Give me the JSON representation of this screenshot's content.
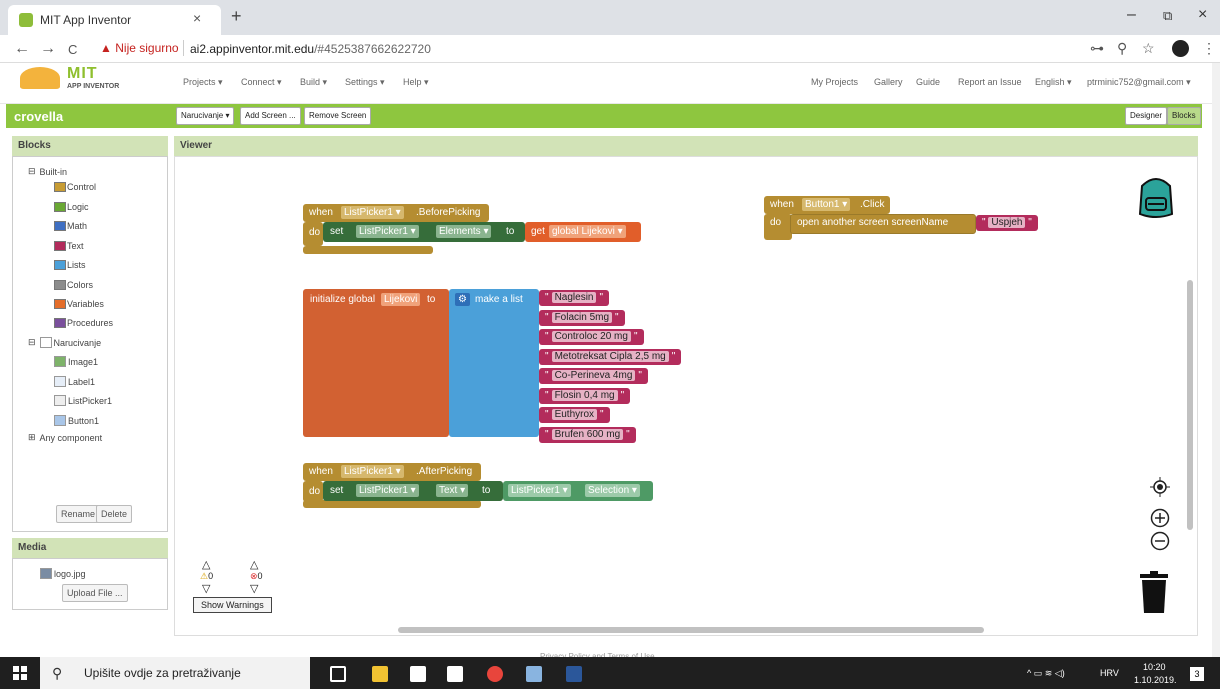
{
  "browser": {
    "tab_title": "MIT App Inventor",
    "tab_close": "×",
    "new_tab": "+",
    "security_warning": "Nije sigurno",
    "url_host": "ai2.appinventor.mit.edu",
    "url_path": "/#4525387662622720",
    "back": "←",
    "forward": "→",
    "reload": "C",
    "warn_icon": "▲",
    "key_icon": "⊶",
    "zoom_icon": "⚲",
    "star_icon": "☆",
    "menu_icon": "⋮",
    "minimize": "–",
    "restore": "⧉",
    "close": "×"
  },
  "app": {
    "logo_mit": "MIT",
    "logo_sub": "APP INVENTOR",
    "menu": [
      {
        "label": "Projects ▾"
      },
      {
        "label": "Connect ▾"
      },
      {
        "label": "Build ▾"
      },
      {
        "label": "Settings ▾"
      },
      {
        "label": "Help ▾"
      }
    ],
    "right_menu": [
      {
        "label": "My Projects"
      },
      {
        "label": "Gallery"
      },
      {
        "label": "Guide"
      },
      {
        "label": "Report an Issue"
      },
      {
        "label": "English ▾"
      },
      {
        "label": "ptrminic752@gmail.com ▾"
      }
    ],
    "project_name": "crovella",
    "screen_select": "Narucivanje ▾",
    "add_screen": "Add Screen ...",
    "remove_screen": "Remove Screen",
    "designer": "Designer",
    "blocks_btn": "Blocks"
  },
  "blocks_panel": {
    "header": "Blocks",
    "builtin": "Built-in",
    "builtin_toggle": "⊟",
    "categories": [
      {
        "label": "Control",
        "color": "#c79c34"
      },
      {
        "label": "Logic",
        "color": "#6aa834"
      },
      {
        "label": "Math",
        "color": "#3f6fc2"
      },
      {
        "label": "Text",
        "color": "#b32c5c"
      },
      {
        "label": "Lists",
        "color": "#4ba0d9"
      },
      {
        "label": "Colors",
        "color": "#8c8c8c"
      },
      {
        "label": "Variables",
        "color": "#e46d2a"
      },
      {
        "label": "Procedures",
        "color": "#7a4f9c"
      }
    ],
    "screen": "Narucivanje",
    "screen_toggle": "⊟",
    "components": [
      {
        "label": "Image1"
      },
      {
        "label": "Label1"
      },
      {
        "label": "ListPicker1"
      },
      {
        "label": "Button1"
      }
    ],
    "any_component": "Any component",
    "any_toggle": "⊞",
    "rename": "Rename",
    "delete": "Delete"
  },
  "media": {
    "header": "Media",
    "file": "logo.jpg",
    "upload": "Upload File ..."
  },
  "viewer": {
    "header": "Viewer",
    "block1": {
      "when": "when",
      "comp": "ListPicker1 ▾",
      "event": ".BeforePicking",
      "do": "do",
      "set": "set",
      "comp2": "ListPicker1 ▾",
      "prop": "Elements ▾",
      "to": "to",
      "get": "get",
      "var": "global Lijekovi ▾"
    },
    "block2": {
      "init": "initialize global",
      "name": "Lijekovi",
      "to": "to",
      "make": "make a list",
      "gear": "⚙",
      "items": [
        {
          "label": "Naglesin"
        },
        {
          "label": "Folacin 5mg"
        },
        {
          "label": "Controloc 20 mg"
        },
        {
          "label": "Metotreksat Cipla 2,5 mg"
        },
        {
          "label": "Co-Perineva 4mg"
        },
        {
          "label": "Flosin 0,4 mg"
        },
        {
          "label": "Euthyrox"
        },
        {
          "label": "Brufen 600 mg"
        }
      ]
    },
    "block3": {
      "when": "when",
      "comp": "ListPicker1 ▾",
      "event": ".AfterPicking",
      "do": "do",
      "set": "set",
      "comp2": "ListPicker1 ▾",
      "prop": "Text ▾",
      "to": "to",
      "comp3": "ListPicker1 ▾",
      "prop3": "Selection ▾"
    },
    "block4": {
      "when": "when",
      "comp": "Button1 ▾",
      "event": ".Click",
      "do": "do",
      "action": "open another screen  screenName",
      "value": "Uspjeh"
    },
    "quote": "\"",
    "warnings_count": "0",
    "errors_count": "0",
    "show_warnings": "Show Warnings",
    "footer": "Privacy Policy and Terms of Use"
  },
  "taskbar": {
    "search": "Upišite ovdje za pretraživanje",
    "lang": "HRV",
    "time": "10:20",
    "date": "1.10.2019.",
    "notif": "3"
  }
}
